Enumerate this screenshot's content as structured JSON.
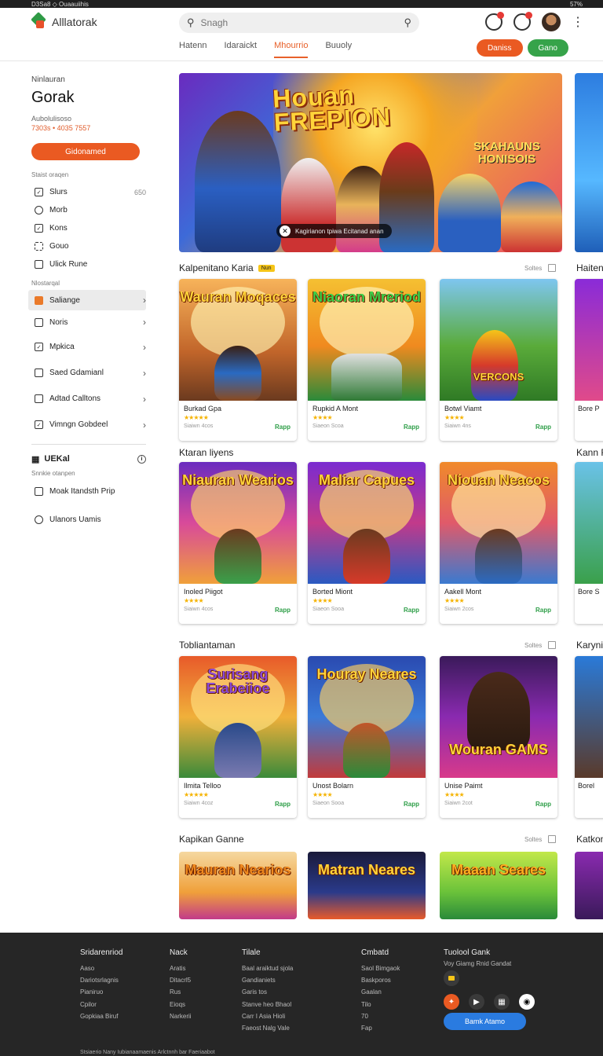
{
  "statusbar": {
    "left": "D3Sa8  ◇  Ouaauiihis",
    "right": "57%"
  },
  "header": {
    "app_title": "Alllatorak",
    "search": {
      "placeholder": "Snagh"
    },
    "tabs": [
      {
        "label": "Hatenn"
      },
      {
        "label": "Idaraickt"
      },
      {
        "label": "Mhourrio"
      },
      {
        "label": "Buuoly"
      }
    ],
    "buttons": {
      "orange": "Daniss",
      "green": "Gano"
    }
  },
  "sidebar": {
    "kicker": "Ninlauran",
    "title": "Gorak",
    "subtitle": "Aubolulisoso",
    "subtitle_meta": "7303s  •  4035  7557",
    "cta": "Gidonamed",
    "section_label": "Staist oraqen",
    "items": [
      {
        "label": "Slurs",
        "count": "650",
        "icon": "square-icon"
      },
      {
        "label": "Morb",
        "icon": "cog-icon"
      },
      {
        "label": "Kons",
        "icon": "square-icon"
      },
      {
        "label": "Gouo",
        "icon": "puzzle-icon"
      },
      {
        "label": "Ulick Rune",
        "icon": "square-icon"
      }
    ],
    "section_label2": "Nlostarqal",
    "items2": [
      {
        "label": "Saliange",
        "icon": "square-icon",
        "active": true
      },
      {
        "label": "Noris",
        "icon": "square-icon"
      },
      {
        "label": "Mpkica",
        "icon": "square-icon"
      },
      {
        "label": "Saed Gdamianl",
        "icon": "square-icon"
      },
      {
        "label": "Adtad Calltons",
        "icon": "square-icon"
      },
      {
        "label": "Vimngn Gobdeel",
        "icon": "square-icon"
      }
    ],
    "footer_head": "UEKal",
    "footer_label": "Snnkie otanpen",
    "footer_items": [
      {
        "label": "Moak Itandsth Prip",
        "icon": "square-icon"
      },
      {
        "label": "Ulanors Uamis",
        "icon": "smile-icon"
      }
    ]
  },
  "hero": {
    "title_line1": "Houan",
    "title_line2": "FREPION",
    "side_title_line1": "SKAHAUNS",
    "side_title_line2": "HONISOIS",
    "caption": "Kagirianon tpiwa Ecitanad anan"
  },
  "sections": [
    {
      "title": "Kalpenitano Karia",
      "badge": "Nun",
      "more": "Soltes",
      "peek_title": "Haiten",
      "cards": [
        {
          "art_text": "Wauran Moqaces",
          "name": "Burkad Gpa",
          "stars": "★★★★★",
          "meta": "Siaiwn    4cos",
          "play": "Rapp"
        },
        {
          "art_text": "Niaoran Mreriod",
          "name": "Rupkid A Mont",
          "stars": "★★★★",
          "meta": "Siaeon    Scoa",
          "play": "Rapp"
        },
        {
          "art_text": "VERCONS",
          "name": "Botwl Viamt",
          "stars": "★★★★",
          "meta": "Siaiwn    4ns",
          "play": "Rapp"
        }
      ],
      "peek_name": "Bore P"
    },
    {
      "title": "Ktaran liyens",
      "more": "",
      "peek_title": "Kann F",
      "cards": [
        {
          "art_text": "Niauran Wearios",
          "name": "Inoled Piigot",
          "stars": "★★★★",
          "meta": "Siaiwn    4cos",
          "play": "Rapp"
        },
        {
          "art_text": "Maliar Capues",
          "name": "Borted Miont",
          "stars": "★★★★",
          "meta": "Siaeon    Sooa",
          "play": "Rapp"
        },
        {
          "art_text": "Niouan Neacos",
          "name": "Aakell Mont",
          "stars": "★★★★",
          "meta": "Siaiwn    2cos",
          "play": "Rapp"
        }
      ],
      "peek_name": "Bore S"
    },
    {
      "title": "Tobliantaman",
      "more": "Soltes",
      "peek_title": "Karyni",
      "cards": [
        {
          "art_text": "Surisang Erabeiioe",
          "name": "Ilmita Telloo",
          "stars": "★★★★★",
          "meta": "Siaiwn    4coz",
          "play": "Rapp"
        },
        {
          "art_text": "Houray Neares",
          "name": "Unost Bolarn",
          "stars": "★★★★",
          "meta": "Siaeon    Sooa",
          "play": "Rapp"
        },
        {
          "art_text": "Wouran GAMS",
          "name": "Unise Paimt",
          "stars": "★★★★",
          "meta": "Siaiwn    2cot",
          "play": "Rapp"
        }
      ],
      "peek_name": "Borel"
    },
    {
      "title": "Kapikan Ganne",
      "more": "Soltes",
      "peek_title": "Katkon",
      "cards": [
        {
          "art_text": "Mauran Nearios",
          "name": "",
          "stars": "",
          "meta": "",
          "play": ""
        },
        {
          "art_text": "Matran Neares",
          "name": "",
          "stars": "",
          "meta": "",
          "play": ""
        },
        {
          "art_text": "Maaan Seares",
          "name": "",
          "stars": "",
          "meta": "",
          "play": ""
        }
      ],
      "peek_name": ""
    }
  ],
  "footer": {
    "columns": [
      {
        "head": "Sridarenriod",
        "items": [
          "Aaso",
          "Dariotsrlagnis",
          "Pianiruo",
          "Cpilor",
          "Gopkiaa Biruf"
        ]
      },
      {
        "head": "Nack",
        "items": [
          "Aratis",
          "Ditacrl5",
          "Rus",
          "Eioqs",
          "Narkerii"
        ]
      },
      {
        "head": "Tilale",
        "items": [
          "Baal araiktud sjola",
          "Gandianiets",
          "Garis tos",
          "Stanve heo Bhaol",
          "Carr I Asia Hioli",
          "Faeost Nalg Vale"
        ]
      },
      {
        "head": "Cmbatd",
        "items": [
          "Saol Bimgaok",
          "Baskporos",
          "Gaalan",
          "Tilo",
          "70",
          "Fap"
        ]
      }
    ],
    "social_head": "Tuolool Gank",
    "social_sub": "Voy Giamg Rnid Gandat",
    "cta": "Bamk Atamo",
    "bottom": "Stsiaerio  Nany Iubianaamaenis Arlctnnh bar Faeriaabot"
  }
}
